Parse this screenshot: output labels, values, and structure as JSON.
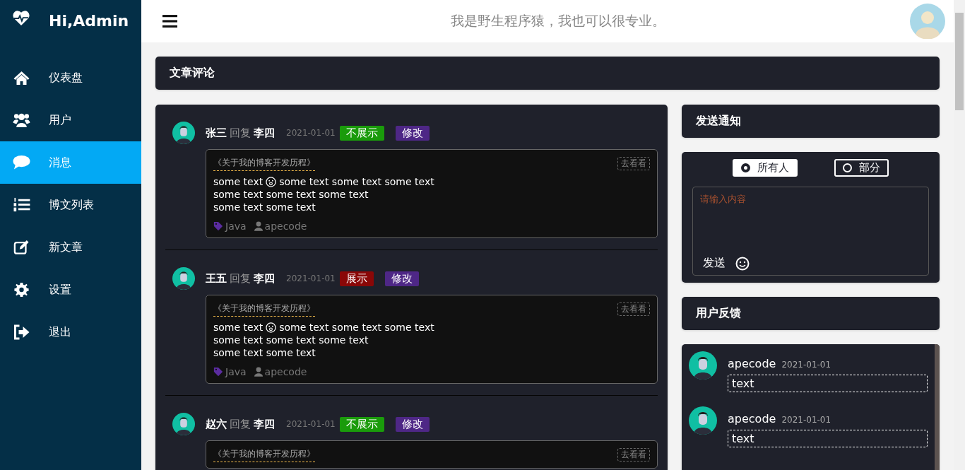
{
  "brand": {
    "title": "Hi,Admin"
  },
  "sidebar": {
    "items": [
      {
        "label": "仪表盘",
        "kind": "home",
        "selected": false
      },
      {
        "label": "用户",
        "kind": "users",
        "selected": false
      },
      {
        "label": "消息",
        "kind": "chat",
        "selected": true
      },
      {
        "label": "博文列表",
        "kind": "list",
        "selected": false
      },
      {
        "label": "新文章",
        "kind": "edit",
        "selected": false
      },
      {
        "label": "设置",
        "kind": "gear",
        "selected": false
      },
      {
        "label": "退出",
        "kind": "exit",
        "selected": false
      }
    ]
  },
  "topbar": {
    "slogan": "我是野生程序猿，我也可以很专业。"
  },
  "comments_panel": {
    "title": "文章评论",
    "comments": [
      {
        "author": "张三",
        "reply_word": "回复",
        "target": "李四",
        "date": "2021-01-01",
        "toggle": {
          "label": "不展示",
          "kind": "hide"
        },
        "edit": "修改",
        "article": "《关于我的博客开发历程》",
        "view": "去看看",
        "content_before": "some text",
        "content_after": "some text some text some text",
        "lines": [
          "some text some text some text",
          "some text some text"
        ],
        "tag": "Java",
        "user": "apecode"
      },
      {
        "author": "王五",
        "reply_word": "回复",
        "target": "李四",
        "date": "2021-01-01",
        "toggle": {
          "label": "展示",
          "kind": "show"
        },
        "edit": "修改",
        "article": "《关于我的博客开发历程》",
        "view": "去看看",
        "content_before": "some text",
        "content_after": "some text some text some text",
        "lines": [
          "some text some text some text",
          "some text some text"
        ],
        "tag": "Java",
        "user": "apecode"
      },
      {
        "author": "赵六",
        "reply_word": "回复",
        "target": "李四",
        "date": "2021-01-01",
        "toggle": {
          "label": "不展示",
          "kind": "hide"
        },
        "edit": "修改",
        "article": "《关于我的博客开发历程》",
        "view": "去看看"
      }
    ]
  },
  "notify": {
    "title": "发送通知",
    "audience": [
      {
        "label": "所有人",
        "selected": true
      },
      {
        "label": "部分",
        "selected": false
      }
    ],
    "placeholder": "请输入内容",
    "send": "发送"
  },
  "feedback": {
    "title": "用户反馈",
    "items": [
      {
        "name": "apecode",
        "date": "2021-01-01",
        "text": "text"
      },
      {
        "name": "apecode",
        "date": "2021-01-01",
        "text": "text"
      }
    ]
  }
}
